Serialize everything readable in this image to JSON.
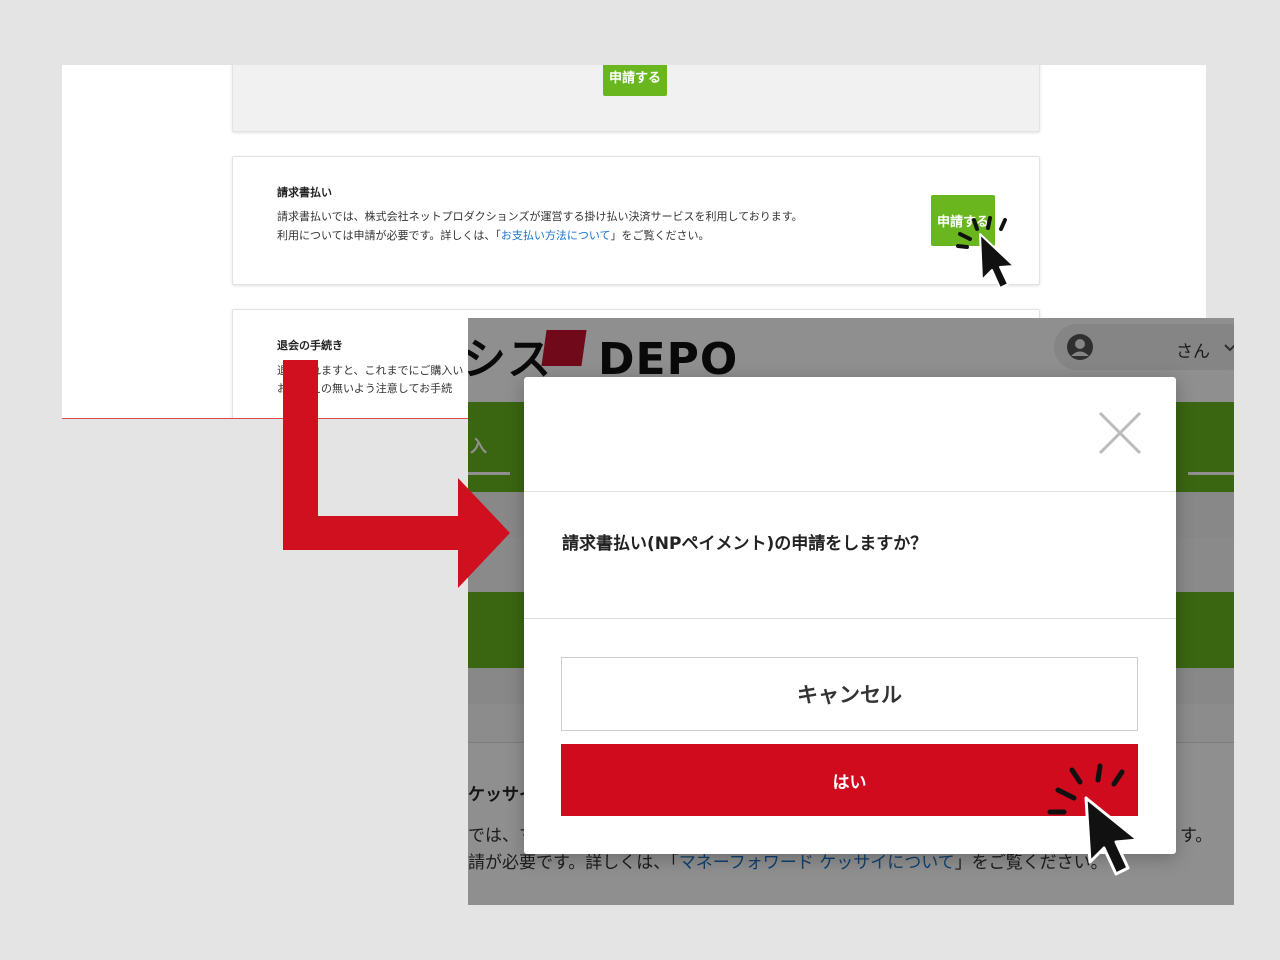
{
  "top_screen": {
    "previous_card_button": "申請する",
    "invoice_card": {
      "title": "請求書払い",
      "text_line1": "請求書払いでは、株式会社ネットプロダクションズが運営する掛け払い決済サービスを利用しております。",
      "text_line2_before": "利用については申請が必要です。詳しくは、「",
      "text_line2_link": "お支払い方法について",
      "text_line2_after": "」をご覧ください。",
      "button": "申請する"
    },
    "withdraw_card": {
      "title": "退会の手続き",
      "text_line1": "退会されますと、これまでにご購入い",
      "text_line2": "お間違えの無いよう注意してお手続"
    }
  },
  "bottom_screen": {
    "logo_left": "シス",
    "logo_right": "DEPO",
    "user_suffix": "さん",
    "tab_fragment": "入",
    "bg_title_fragment": "ケッサイ",
    "bg_text_line1_start": "では、マ",
    "bg_text_line1_end": "す。",
    "bg_text_line2_before": "請が必要です。詳しくは、「",
    "bg_text_line2_link": "マネーフォワード ケッサイについて",
    "bg_text_line2_after": "」をご覧ください。",
    "modal": {
      "question": "請求書払い(NPペイメント)の申請をしますか？",
      "cancel_label": "キャンセル",
      "yes_label": "はい"
    }
  },
  "colors": {
    "brand_green": "#6ab61f",
    "brand_red": "#cf0b1d",
    "arrow_red": "#d0101f",
    "link_blue": "#1a73c8"
  },
  "icons": [
    "close-icon",
    "user-avatar-icon",
    "chevron-down-icon",
    "pointer-cursor-icon",
    "flow-arrow-icon"
  ]
}
